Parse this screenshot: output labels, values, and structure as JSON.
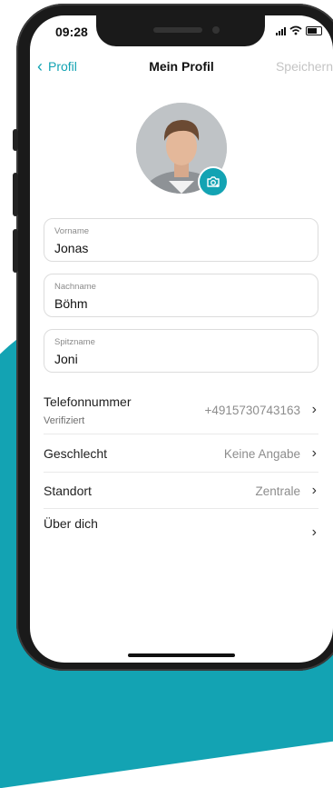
{
  "status_bar": {
    "time": "09:28"
  },
  "nav": {
    "back_label": "Profil",
    "title": "Mein Profil",
    "save_label": "Speichern"
  },
  "fields": [
    {
      "label": "Vorname",
      "value": "Jonas"
    },
    {
      "label": "Nachname",
      "value": "Böhm"
    },
    {
      "label": "Spitzname",
      "value": "Joni"
    }
  ],
  "rows": {
    "phone": {
      "title": "Telefonnummer",
      "subtitle": "Verifiziert",
      "value": "+4915730743163"
    },
    "gender": {
      "title": "Geschlecht",
      "value": "Keine Angabe"
    },
    "location": {
      "title": "Standort",
      "value": "Zentrale"
    },
    "about": {
      "title": "Über dich"
    }
  },
  "colors": {
    "accent": "#13a3b3",
    "save_disabled": "#c4c4c4"
  },
  "icons": [
    "chevron-left-icon",
    "camera-add-icon",
    "chevron-right-icon",
    "signal-icon",
    "wifi-icon",
    "battery-icon"
  ]
}
